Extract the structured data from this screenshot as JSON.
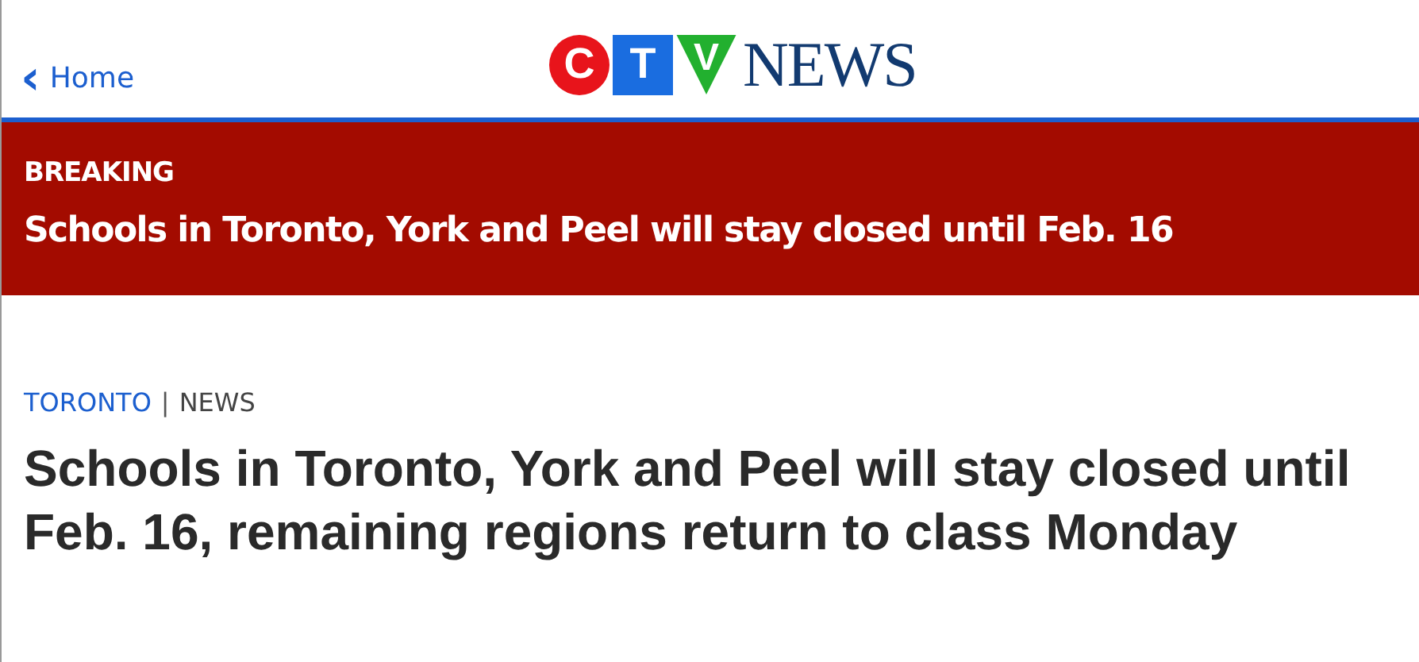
{
  "header": {
    "back_link": {
      "icon": "‹",
      "label": "Home"
    },
    "logo": {
      "letters": [
        {
          "char": "C",
          "kind": "circle",
          "color": "#e8141b"
        },
        {
          "char": "T",
          "kind": "square",
          "color": "#1a6de0"
        },
        {
          "char": "V",
          "kind": "triangle",
          "color": "#22b02f"
        }
      ],
      "word": "NEWS"
    }
  },
  "breaking": {
    "label": "BREAKING",
    "headline": "Schools in Toronto, York and Peel will stay closed until Feb. 16"
  },
  "article": {
    "section": "TORONTO",
    "separator": "|",
    "category": "NEWS",
    "headline": "Schools in Toronto, York and Peel will stay closed until Feb. 16, remaining regions return to class Monday"
  }
}
